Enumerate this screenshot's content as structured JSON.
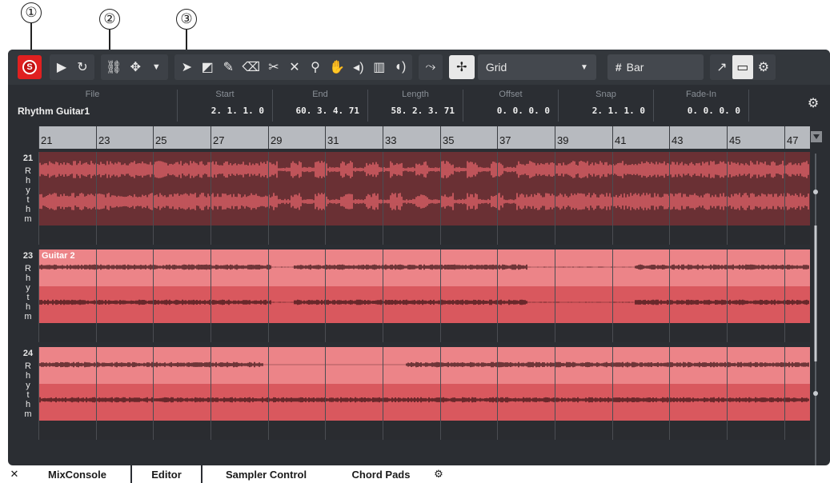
{
  "callouts": [
    "①",
    "②",
    "③"
  ],
  "toolbar": {
    "snap_type": "Grid",
    "quantize": "Bar",
    "icons": [
      "solo-icon",
      "play-icon",
      "loop-icon",
      "link-icon",
      "move-icon",
      "pointer-icon",
      "range-icon",
      "pencil-icon",
      "eraser-icon",
      "scissors-icon",
      "mute-icon",
      "zoom-icon",
      "hand-icon",
      "speaker-icon",
      "wave-icon",
      "volume-icon",
      "snap-icon",
      "grid-hash-icon",
      "external-icon",
      "window-icon",
      "gear-icon"
    ]
  },
  "infoline": {
    "file_label": "File",
    "file_value": "Rhythm Guitar1",
    "start_label": "Start",
    "start_value": "2. 1. 1.   0",
    "end_label": "End",
    "end_value": "60. 3. 4. 71",
    "length_label": "Length",
    "length_value": "58. 2. 3. 71",
    "offset_label": "Offset",
    "offset_value": "0. 0. 0.   0",
    "snap_label": "Snap",
    "snap_value": "2. 1. 1.   0",
    "fadein_label": "Fade-In",
    "fadein_value": "0. 0. 0.   0"
  },
  "ruler": [
    "21",
    "23",
    "25",
    "27",
    "29",
    "31",
    "33",
    "35",
    "37",
    "39",
    "41",
    "43",
    "45",
    "47"
  ],
  "lanes": [
    {
      "number": "21",
      "name": [
        "R",
        "h",
        "y",
        "t",
        "h",
        "m"
      ],
      "event_title": ""
    },
    {
      "number": "23",
      "name": [
        "R",
        "h",
        "y",
        "t",
        "h",
        "m"
      ],
      "event_title": "Guitar 2"
    },
    {
      "number": "24",
      "name": [
        "R",
        "h",
        "y",
        "t",
        "h",
        "m"
      ],
      "event_title": ""
    }
  ],
  "tabs": {
    "close": "✕",
    "mixconsole": "MixConsole",
    "editor": "Editor",
    "sampler": "Sampler Control",
    "chordpads": "Chord Pads"
  },
  "colors": {
    "accent": "#e02020",
    "event": "#d9585e",
    "event_light": "#ec8488",
    "waveform": "#3a1416"
  }
}
